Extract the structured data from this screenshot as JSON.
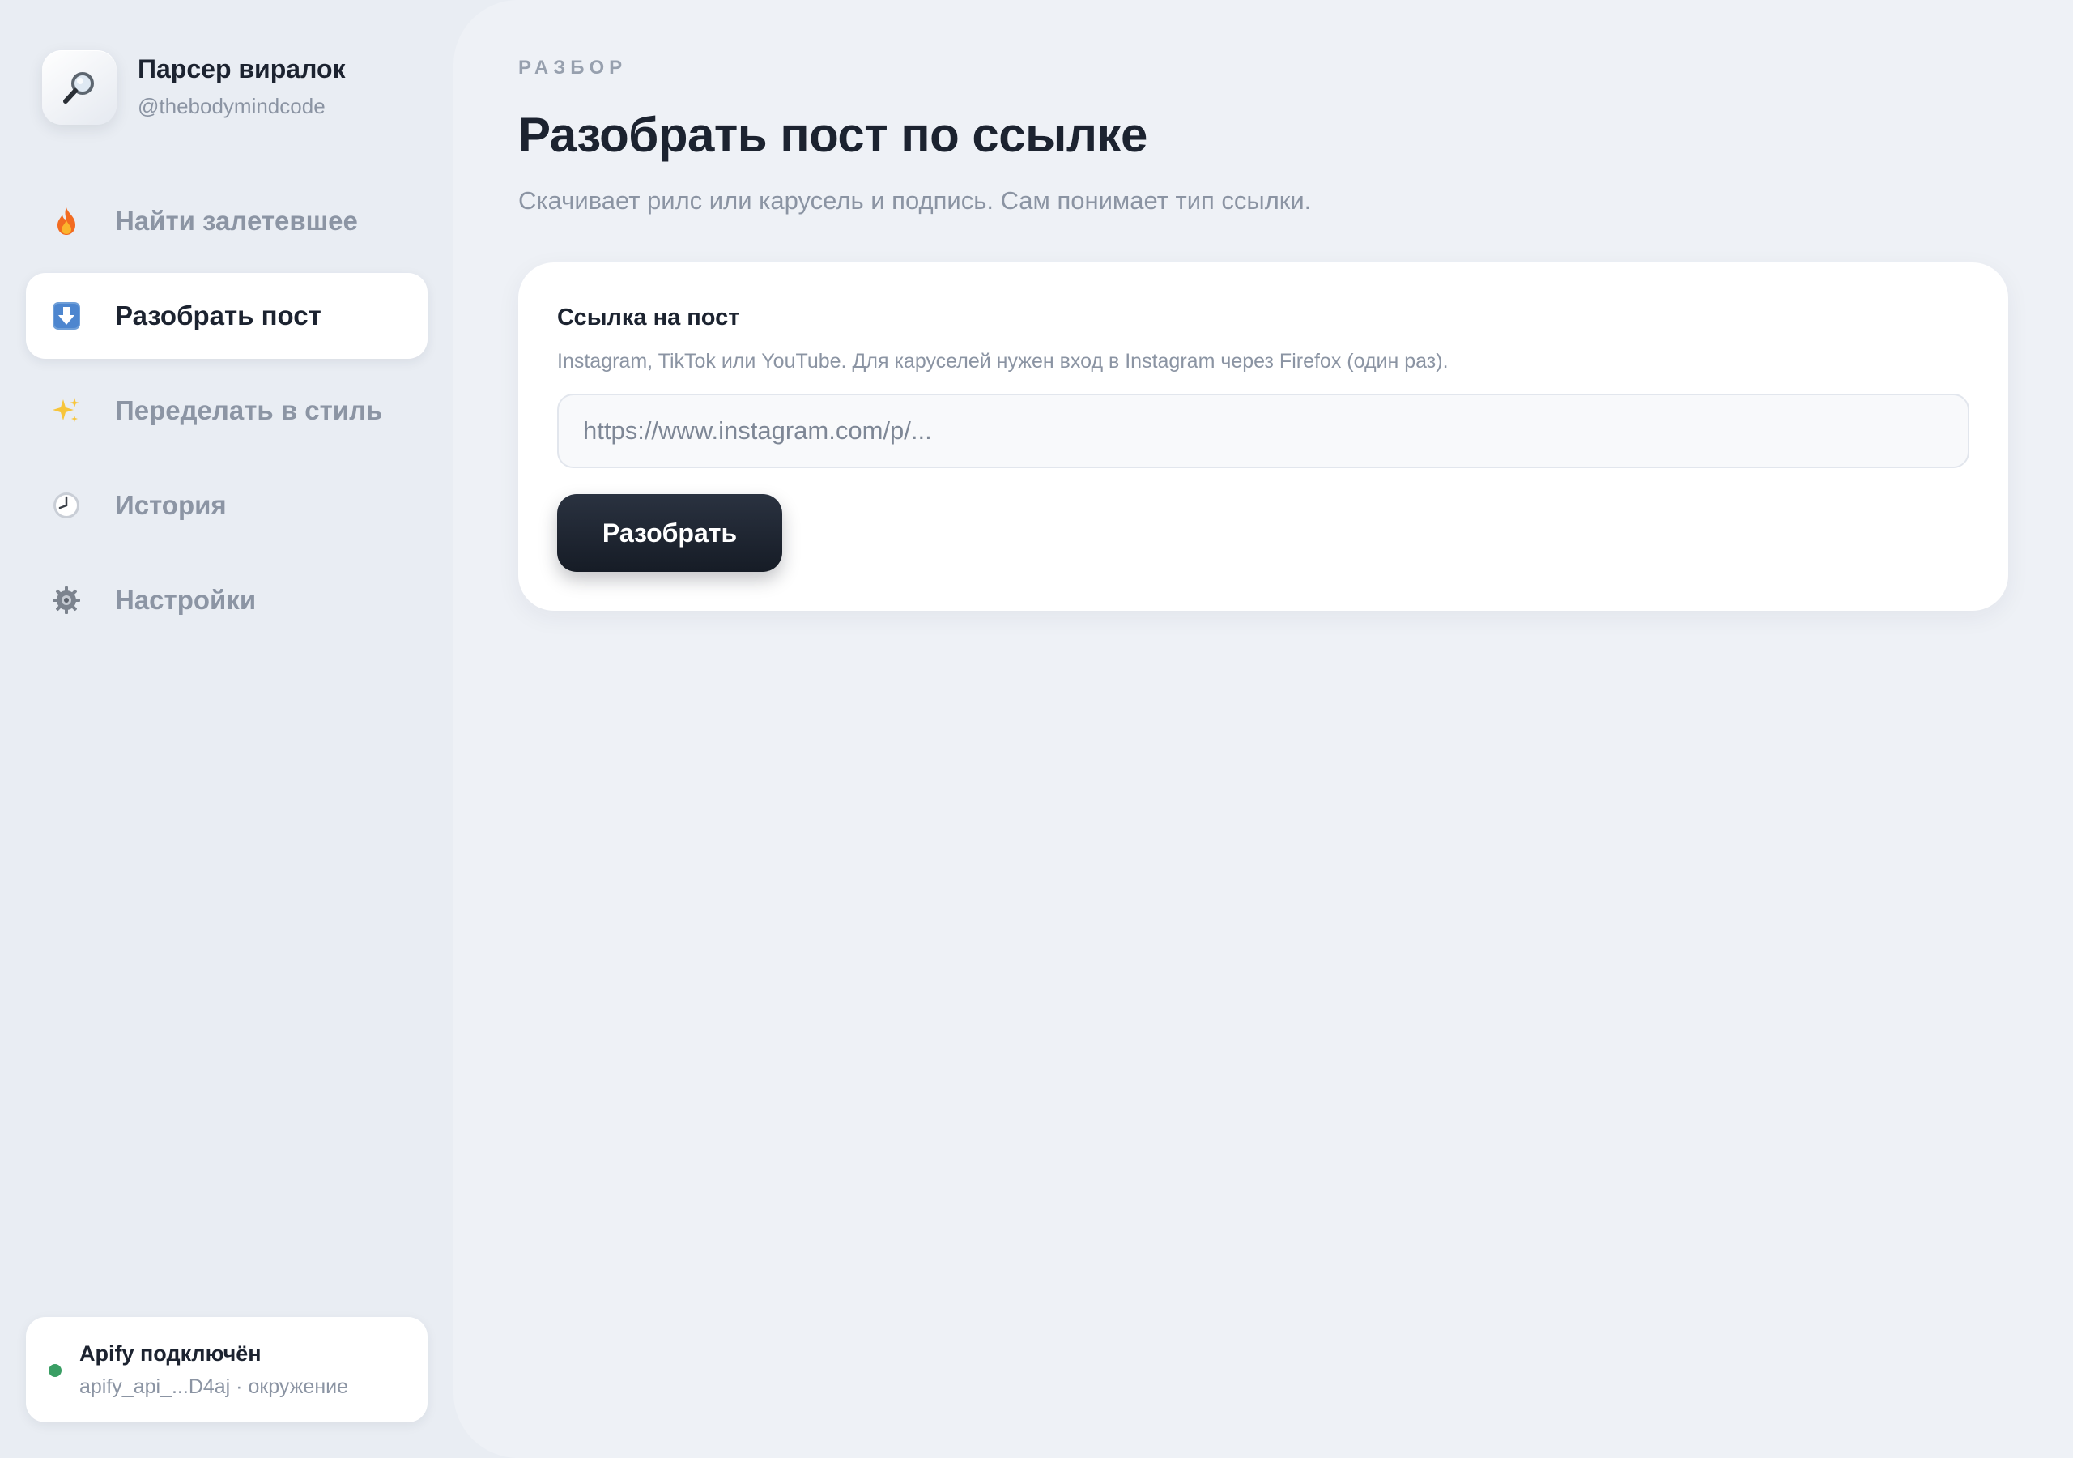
{
  "brand": {
    "title": "Парсер виралок",
    "handle": "@thebodymindcode",
    "logo_icon": "magnifying-glass-icon"
  },
  "nav": {
    "items": [
      {
        "label": "Найти залетевшее",
        "icon": "fire-icon",
        "active": false
      },
      {
        "label": "Разобрать пост",
        "icon": "download-arrow-icon",
        "active": true
      },
      {
        "label": "Переделать в стиль",
        "icon": "sparkles-icon",
        "active": false
      },
      {
        "label": "История",
        "icon": "clock-icon",
        "active": false
      },
      {
        "label": "Настройки",
        "icon": "gear-icon",
        "active": false
      }
    ]
  },
  "status": {
    "title": "Apify подключён",
    "subtitle": "apify_api_...D4aj · окружение",
    "color": "#3a9e64"
  },
  "main": {
    "eyebrow": "РАЗБОР",
    "title": "Разобрать пост по ссылке",
    "subtitle": "Скачивает рилс или карусель и подпись. Сам понимает тип ссылки."
  },
  "form": {
    "label": "Ссылка на пост",
    "hint": "Instagram, TikTok или YouTube. Для каруселей нужен вход в Instagram через Firefox (один раз).",
    "placeholder": "https://www.instagram.com/p/...",
    "value": "",
    "submit_label": "Разобрать"
  },
  "colors": {
    "text_primary": "#1c2330",
    "text_muted": "#8b94a3",
    "button_dark": "#1c2330",
    "active_nav_bg": "#ffffff"
  }
}
